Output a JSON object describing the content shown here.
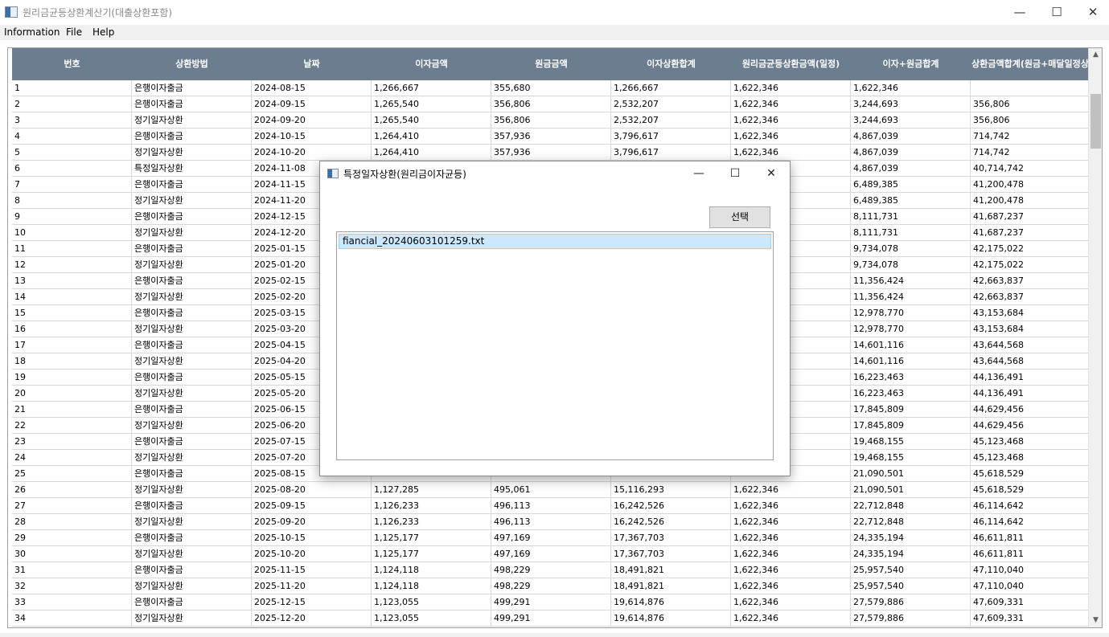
{
  "window": {
    "title": "원리금균등상환계산기(대출상환포함)",
    "minimize": "—",
    "maximize": "☐",
    "close": "✕"
  },
  "menu": [
    "Information",
    "File",
    "Help"
  ],
  "grid": {
    "headers": [
      "번호",
      "상환방법",
      "날짜",
      "이자금액",
      "원금금액",
      "이자상환합계",
      "원리금균등상환금액(일정)",
      "이자+원금합계",
      "상환금액합계(원금+매달일정상"
    ],
    "rows": [
      [
        "1",
        "은행이자출금",
        "2024-08-15",
        "1,266,667",
        "355,680",
        "1,266,667",
        "1,622,346",
        "1,622,346",
        ""
      ],
      [
        "2",
        "은행이자출금",
        "2024-09-15",
        "1,265,540",
        "356,806",
        "2,532,207",
        "1,622,346",
        "3,244,693",
        "356,806"
      ],
      [
        "3",
        "정기일자상환",
        "2024-09-20",
        "1,265,540",
        "356,806",
        "2,532,207",
        "1,622,346",
        "3,244,693",
        "356,806"
      ],
      [
        "4",
        "은행이자출금",
        "2024-10-15",
        "1,264,410",
        "357,936",
        "3,796,617",
        "1,622,346",
        "4,867,039",
        "714,742"
      ],
      [
        "5",
        "정기일자상환",
        "2024-10-20",
        "1,264,410",
        "357,936",
        "3,796,617",
        "1,622,346",
        "4,867,039",
        "714,742"
      ],
      [
        "6",
        "특정일자상환",
        "2024-11-08",
        "",
        "",
        "",
        "",
        "4,867,039",
        "40,714,742"
      ],
      [
        "7",
        "은행이자출금",
        "2024-11-15",
        "",
        "",
        "",
        "",
        "6,489,385",
        "41,200,478"
      ],
      [
        "8",
        "정기일자상환",
        "2024-11-20",
        "",
        "",
        "",
        "",
        "6,489,385",
        "41,200,478"
      ],
      [
        "9",
        "은행이자출금",
        "2024-12-15",
        "",
        "",
        "",
        "",
        "8,111,731",
        "41,687,237"
      ],
      [
        "10",
        "정기일자상환",
        "2024-12-20",
        "",
        "",
        "",
        "",
        "8,111,731",
        "41,687,237"
      ],
      [
        "11",
        "은행이자출금",
        "2025-01-15",
        "",
        "",
        "",
        "",
        "9,734,078",
        "42,175,022"
      ],
      [
        "12",
        "정기일자상환",
        "2025-01-20",
        "",
        "",
        "",
        "",
        "9,734,078",
        "42,175,022"
      ],
      [
        "13",
        "은행이자출금",
        "2025-02-15",
        "",
        "",
        "",
        "",
        "11,356,424",
        "42,663,837"
      ],
      [
        "14",
        "정기일자상환",
        "2025-02-20",
        "",
        "",
        "",
        "",
        "11,356,424",
        "42,663,837"
      ],
      [
        "15",
        "은행이자출금",
        "2025-03-15",
        "",
        "",
        "",
        "",
        "12,978,770",
        "43,153,684"
      ],
      [
        "16",
        "정기일자상환",
        "2025-03-20",
        "",
        "",
        "",
        "",
        "12,978,770",
        "43,153,684"
      ],
      [
        "17",
        "은행이자출금",
        "2025-04-15",
        "",
        "",
        "",
        "",
        "14,601,116",
        "43,644,568"
      ],
      [
        "18",
        "정기일자상환",
        "2025-04-20",
        "",
        "",
        "",
        "",
        "14,601,116",
        "43,644,568"
      ],
      [
        "19",
        "은행이자출금",
        "2025-05-15",
        "",
        "",
        "",
        "",
        "16,223,463",
        "44,136,491"
      ],
      [
        "20",
        "정기일자상환",
        "2025-05-20",
        "",
        "",
        "",
        "",
        "16,223,463",
        "44,136,491"
      ],
      [
        "21",
        "은행이자출금",
        "2025-06-15",
        "",
        "",
        "",
        "",
        "17,845,809",
        "44,629,456"
      ],
      [
        "22",
        "정기일자상환",
        "2025-06-20",
        "",
        "",
        "",
        "",
        "17,845,809",
        "44,629,456"
      ],
      [
        "23",
        "은행이자출금",
        "2025-07-15",
        "",
        "",
        "",
        "",
        "19,468,155",
        "45,123,468"
      ],
      [
        "24",
        "정기일자상환",
        "2025-07-20",
        "",
        "",
        "",
        "",
        "19,468,155",
        "45,123,468"
      ],
      [
        "25",
        "은행이자출금",
        "2025-08-15",
        "",
        "",
        "",
        "",
        "21,090,501",
        "45,618,529"
      ],
      [
        "26",
        "정기일자상환",
        "2025-08-20",
        "1,127,285",
        "495,061",
        "15,116,293",
        "1,622,346",
        "21,090,501",
        "45,618,529"
      ],
      [
        "27",
        "은행이자출금",
        "2025-09-15",
        "1,126,233",
        "496,113",
        "16,242,526",
        "1,622,346",
        "22,712,848",
        "46,114,642"
      ],
      [
        "28",
        "정기일자상환",
        "2025-09-20",
        "1,126,233",
        "496,113",
        "16,242,526",
        "1,622,346",
        "22,712,848",
        "46,114,642"
      ],
      [
        "29",
        "은행이자출금",
        "2025-10-15",
        "1,125,177",
        "497,169",
        "17,367,703",
        "1,622,346",
        "24,335,194",
        "46,611,811"
      ],
      [
        "30",
        "정기일자상환",
        "2025-10-20",
        "1,125,177",
        "497,169",
        "17,367,703",
        "1,622,346",
        "24,335,194",
        "46,611,811"
      ],
      [
        "31",
        "은행이자출금",
        "2025-11-15",
        "1,124,118",
        "498,229",
        "18,491,821",
        "1,622,346",
        "25,957,540",
        "47,110,040"
      ],
      [
        "32",
        "정기일자상환",
        "2025-11-20",
        "1,124,118",
        "498,229",
        "18,491,821",
        "1,622,346",
        "25,957,540",
        "47,110,040"
      ],
      [
        "33",
        "은행이자출금",
        "2025-12-15",
        "1,123,055",
        "499,291",
        "19,614,876",
        "1,622,346",
        "27,579,886",
        "47,609,331"
      ],
      [
        "34",
        "정기일자상환",
        "2025-12-20",
        "1,123,055",
        "499,291",
        "19,614,876",
        "1,622,346",
        "27,579,886",
        "47,609,331"
      ]
    ]
  },
  "dialog": {
    "title": "특정일자상환(원리금이자균등)",
    "minimize": "—",
    "maximize": "☐",
    "close": "✕",
    "select_label": "선택",
    "files": [
      "fiancial_20240603101259.txt"
    ]
  },
  "colors": {
    "header_bg": "#6b7d8f",
    "selection_bg": "#cce8ff"
  }
}
